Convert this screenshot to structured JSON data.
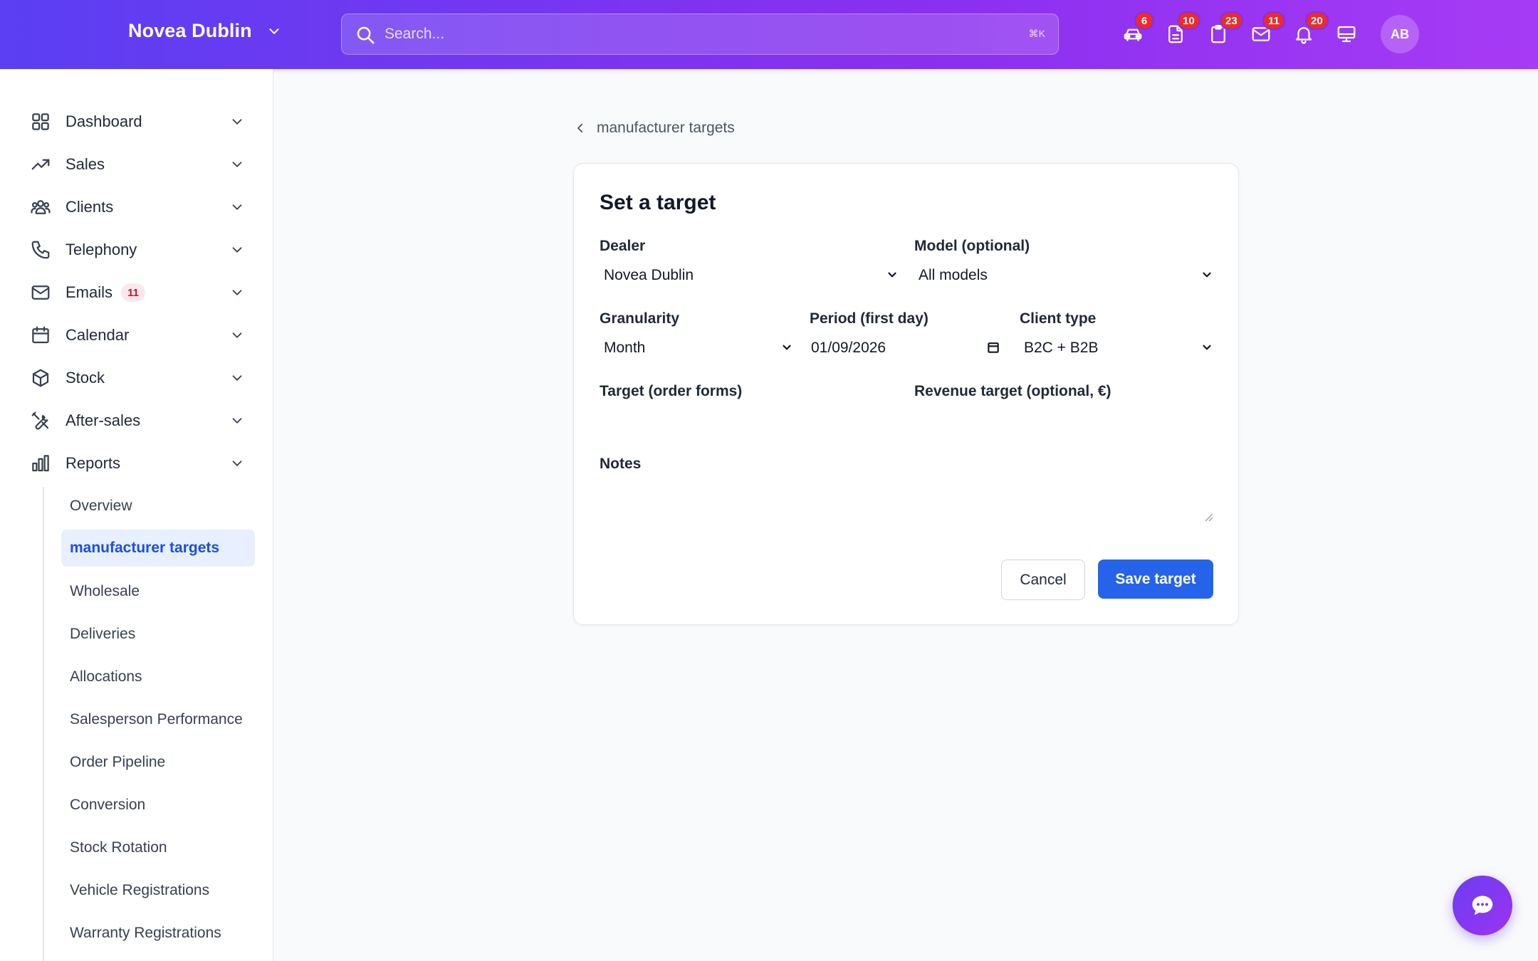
{
  "header": {
    "brand": "Novea Dublin",
    "search_placeholder": "Search...",
    "search_shortcut": "⌘K",
    "icons": [
      {
        "name": "car-icon",
        "badge": "6"
      },
      {
        "name": "document-icon",
        "badge": "10"
      },
      {
        "name": "clipboard-icon",
        "badge": "23"
      },
      {
        "name": "mail-icon",
        "badge": "11"
      },
      {
        "name": "bell-icon",
        "badge": "20"
      },
      {
        "name": "monitor-icon",
        "badge": ""
      }
    ],
    "avatar_initials": "AB"
  },
  "sidebar": {
    "items": [
      {
        "label": "Dashboard",
        "icon": "grid-icon"
      },
      {
        "label": "Sales",
        "icon": "trending-up-icon"
      },
      {
        "label": "Clients",
        "icon": "users-icon"
      },
      {
        "label": "Telephony",
        "icon": "phone-icon"
      },
      {
        "label": "Emails",
        "icon": "mail-icon",
        "badge": "11"
      },
      {
        "label": "Calendar",
        "icon": "calendar-icon"
      },
      {
        "label": "Stock",
        "icon": "box-icon"
      },
      {
        "label": "After-sales",
        "icon": "tools-icon"
      },
      {
        "label": "Reports",
        "icon": "bar-chart-icon"
      }
    ],
    "reports_sub": [
      "Overview",
      "manufacturer targets",
      "Wholesale",
      "Deliveries",
      "Allocations",
      "Salesperson Performance",
      "Order Pipeline",
      "Conversion",
      "Stock Rotation",
      "Vehicle Registrations",
      "Warranty Registrations"
    ],
    "active_sub": "manufacturer targets"
  },
  "breadcrumb": {
    "back_label": "manufacturer targets"
  },
  "form": {
    "title": "Set a target",
    "dealer_label": "Dealer",
    "dealer_value": "Novea Dublin",
    "model_label": "Model (optional)",
    "model_value": "All models",
    "granularity_label": "Granularity",
    "granularity_value": "Month",
    "period_label": "Period (first day)",
    "period_value": "01/09/2026",
    "client_type_label": "Client type",
    "client_type_value": "B2C + B2B",
    "target_label": "Target (order forms)",
    "revenue_label": "Revenue target (optional, €)",
    "notes_label": "Notes",
    "cancel_label": "Cancel",
    "save_label": "Save target"
  },
  "colors": {
    "header_gradient_start": "#5b3ff2",
    "header_gradient_end": "#a63bf5",
    "primary_button": "#2563eb",
    "badge_red": "#ef2a2a",
    "active_nav_bg": "#e8efff",
    "active_nav_text": "#1d4ed8"
  }
}
